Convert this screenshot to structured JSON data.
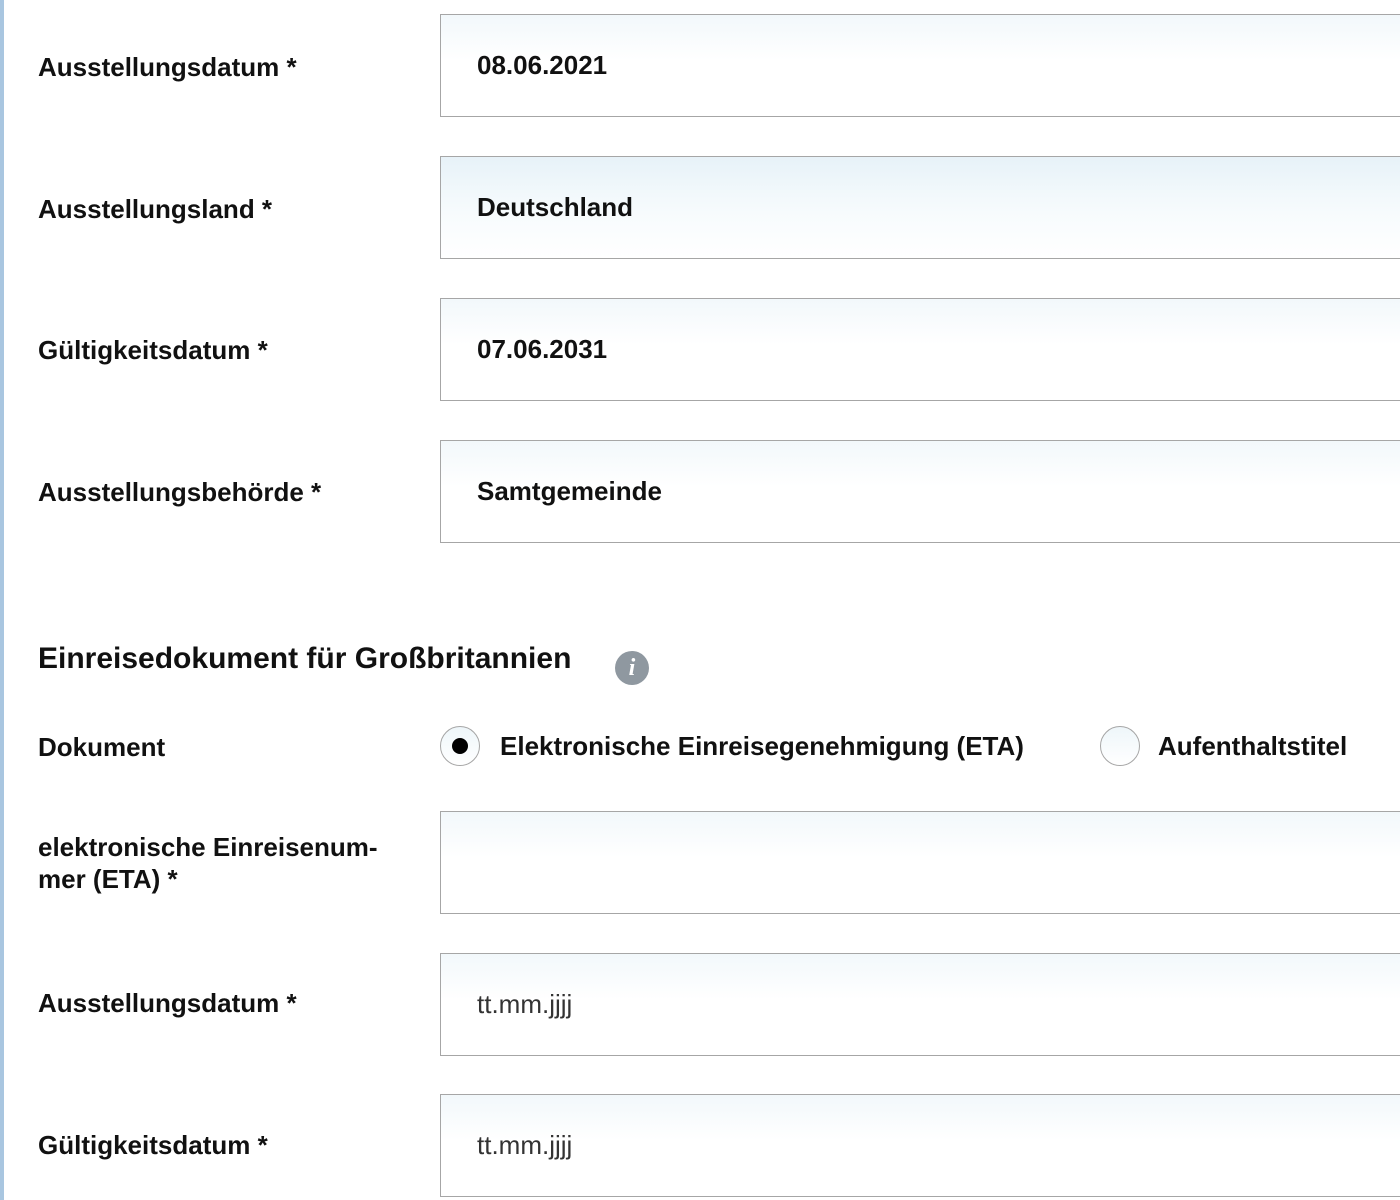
{
  "passport": {
    "issue_date": {
      "label": "Ausstellungsdatum *",
      "value": "08.06.2021"
    },
    "issue_country": {
      "label": "Ausstellungsland *",
      "value": "Deutschland"
    },
    "expiry_date": {
      "label": "Gültigkeitsdatum *",
      "value": "07.06.2031"
    },
    "issuing_authority": {
      "label": "Ausstellungsbehörde *",
      "value": "Samtgemeinde"
    }
  },
  "uk_entry": {
    "title": "Einreisedokument für Großbritannien",
    "info_icon": "info-icon",
    "document": {
      "label": "Dokument",
      "options": [
        {
          "label": "Elektronische Einreisegenehmigung (ETA)",
          "checked": true
        },
        {
          "label": "Aufenthaltstitel",
          "checked": false
        }
      ]
    },
    "eta_number": {
      "label_line1": "elektronische Einreisenum-",
      "label_line2": "mer (ETA) *",
      "value": ""
    },
    "issue_date": {
      "label": "Ausstellungsdatum *",
      "placeholder": "tt.mm.jjjj"
    },
    "expiry_date": {
      "label": "Gültigkeitsdatum *",
      "placeholder": "tt.mm.jjjj"
    }
  },
  "colors": {
    "left_rule": "#a9c6e0",
    "field_border": "#a6a6a6",
    "info_icon": "#8f98a0"
  }
}
